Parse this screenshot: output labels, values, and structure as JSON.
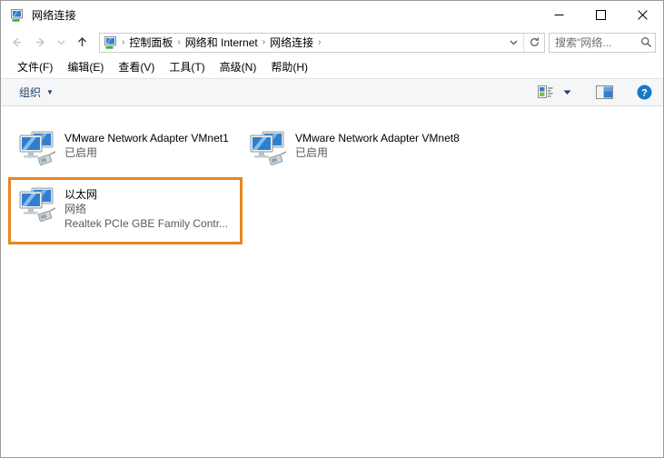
{
  "window": {
    "title": "网络连接",
    "title_icon": "network-connections-icon",
    "controls": {
      "minimize": "—",
      "maximize": "☐",
      "close": "✕"
    }
  },
  "addressbar": {
    "back_icon": "back-arrow-icon",
    "forward_icon": "forward-arrow-icon",
    "recent_icon": "chevron-down-icon",
    "up_icon": "up-arrow-icon",
    "crumb_icon": "network-connections-icon",
    "separator": "›",
    "crumbs": [
      "控制面板",
      "网络和 Internet",
      "网络连接"
    ],
    "dropdown_icon": "chevron-down-icon",
    "refresh_icon": "refresh-icon",
    "refresh_glyph": "↻"
  },
  "search": {
    "placeholder": "搜索\"网络...",
    "icon": "search-icon"
  },
  "menubar": {
    "items": [
      "文件(F)",
      "编辑(E)",
      "查看(V)",
      "工具(T)",
      "高级(N)",
      "帮助(H)"
    ]
  },
  "toolbar": {
    "organize_label": "组织",
    "organize_caret": "▼",
    "view_options_icon": "view-options-icon",
    "view_caret": "▼",
    "preview_pane_icon": "preview-pane-icon",
    "help_icon": "help-icon",
    "help_glyph": "?"
  },
  "connections": [
    {
      "name": "VMware Network Adapter VMnet1",
      "status": "已启用",
      "description": "",
      "icon": "network-adapter-icon",
      "highlighted": false
    },
    {
      "name": "VMware Network Adapter VMnet8",
      "status": "已启用",
      "description": "",
      "icon": "network-adapter-icon",
      "highlighted": false
    },
    {
      "name": "以太网",
      "status": "网络",
      "description": "Realtek PCIe GBE Family Contr...",
      "icon": "network-adapter-icon",
      "highlighted": true
    }
  ],
  "colors": {
    "highlight_border": "#e8861e",
    "toolbar_bg": "#f5f6f7",
    "organize_text": "#1f3f6b",
    "help_blue": "#1878c8",
    "status_text": "#5a5a5a"
  }
}
